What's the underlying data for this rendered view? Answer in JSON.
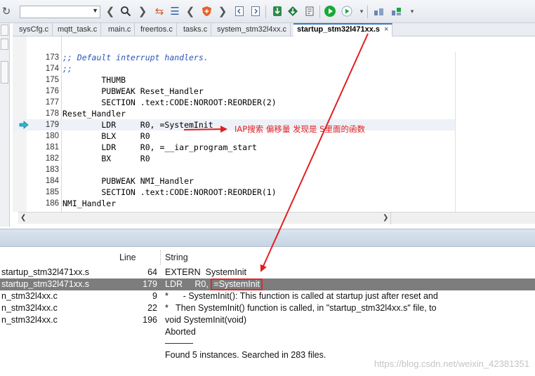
{
  "toolbar": {
    "items": [
      {
        "name": "refresh-icon",
        "glyph": "↻"
      },
      {
        "name": "back-icon",
        "glyph": "❮"
      },
      {
        "name": "find-icon",
        "glyph": "🔍"
      },
      {
        "name": "forward-icon",
        "glyph": "❯"
      },
      {
        "name": "toggle-bookmark-icon",
        "glyph": "⇆"
      },
      {
        "name": "next-bookmark-icon",
        "glyph": "☰"
      },
      {
        "name": "nav-left-icon",
        "glyph": "❮"
      },
      {
        "name": "shield-icon",
        "glyph": "✚"
      },
      {
        "name": "nav-right-icon",
        "glyph": "❯"
      },
      {
        "name": "open-file-icon",
        "glyph": "▭"
      },
      {
        "name": "save-file-icon",
        "glyph": "▭"
      },
      {
        "name": "download-icon",
        "glyph": "⬇"
      },
      {
        "name": "download-debug-icon",
        "glyph": "⬇"
      },
      {
        "name": "debug-icon",
        "glyph": "▶"
      },
      {
        "name": "run-icon",
        "glyph": "▶"
      },
      {
        "name": "layout-icon",
        "glyph": "▦"
      },
      {
        "name": "layout-2-icon",
        "glyph": "▦"
      }
    ],
    "colors": {
      "go": "#1aa83a",
      "download": "#1f7a3d",
      "shield": "#e6612a"
    }
  },
  "tabs": [
    {
      "label": "sysCfg.c",
      "active": false
    },
    {
      "label": "mqtt_task.c",
      "active": false
    },
    {
      "label": "main.c",
      "active": false
    },
    {
      "label": "freertos.c",
      "active": false
    },
    {
      "label": "tasks.c",
      "active": false
    },
    {
      "label": "system_stm32l4xx.c",
      "active": false
    },
    {
      "label": "startup_stm32l471xx.s",
      "active": true,
      "close": "×"
    }
  ],
  "editor": {
    "lines": [
      {
        "num": "173",
        "text": ";; Default interrupt handlers.",
        "comment": true
      },
      {
        "num": "174",
        "text": ";;",
        "comment": true
      },
      {
        "num": "175",
        "text": "        THUMB"
      },
      {
        "num": "176",
        "text": "        PUBWEAK Reset_Handler"
      },
      {
        "num": "177",
        "text": "        SECTION .text:CODE:NOROOT:REORDER(2)"
      },
      {
        "num": "178",
        "text": "Reset_Handler"
      },
      {
        "num": "179",
        "text": "        LDR     R0, =SystemInit",
        "current": true
      },
      {
        "num": "180",
        "text": "        BLX     R0"
      },
      {
        "num": "181",
        "text": "        LDR     R0, =__iar_program_start"
      },
      {
        "num": "182",
        "text": "        BX      R0"
      },
      {
        "num": "183",
        "text": ""
      },
      {
        "num": "184",
        "text": "        PUBWEAK NMI_Handler"
      },
      {
        "num": "185",
        "text": "        SECTION .text:CODE:NOROOT:REORDER(1)"
      },
      {
        "num": "186",
        "text": "NMI_Handler"
      }
    ]
  },
  "annotation": {
    "text": "IAP搜索 偏移量 发现是 S里面的函数",
    "color": "#e02020"
  },
  "results": {
    "headers": {
      "line": "Line",
      "string": "String"
    },
    "rows": [
      {
        "file": "startup_stm32l471xx.s",
        "line": "64",
        "string": "EXTERN  SystemInit",
        "selected": false
      },
      {
        "file": "startup_stm32l471xx.s",
        "line": "179",
        "string_prefix": "LDR     R0, ",
        "string_highlight": "=SystemInit",
        "selected": true
      },
      {
        "file": "n_stm32l4xx.c",
        "line": "9",
        "string": "*      - SystemInit(): This function is called at startup just after reset and",
        "selected": false
      },
      {
        "file": "n_stm32l4xx.c",
        "line": "22",
        "string": "*   Then SystemInit() function is called, in \"startup_stm32l4xx.s\" file, to",
        "selected": false
      },
      {
        "file": "n_stm32l4xx.c",
        "line": "196",
        "string": "void SystemInit(void)",
        "selected": false
      },
      {
        "file": "",
        "line": "",
        "string": "Aborted",
        "selected": false
      }
    ],
    "summary": "Found 5 instances. Searched in 283 files.",
    "selected_color": "#7d7d7d"
  },
  "watermark": "https://blog.csdn.net/weixin_42381351"
}
